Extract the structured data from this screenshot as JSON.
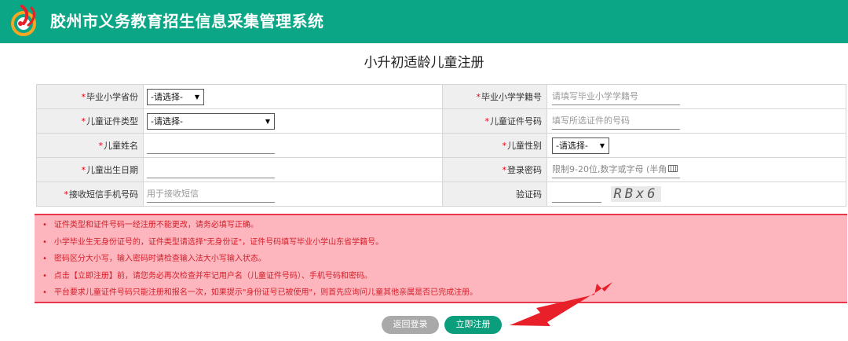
{
  "header": {
    "system_title": "胶州市义务教育招生信息采集管理系统",
    "logo_icon": "school-emblem-icon",
    "background_color": "#0aa685"
  },
  "page": {
    "title": "小升初适龄儿童注册"
  },
  "form": {
    "required_mark": "*",
    "primary_school_province": {
      "label": "毕业小学省份",
      "value": "-请选择-"
    },
    "primary_school_student_no": {
      "label": "毕业小学学籍号",
      "placeholder": "请填写毕业小学学籍号"
    },
    "child_id_type": {
      "label": "儿童证件类型",
      "value": "-请选择-"
    },
    "child_id_no": {
      "label": "儿童证件号码",
      "placeholder": "填写所选证件的号码"
    },
    "child_name": {
      "label": "儿童姓名",
      "value": ""
    },
    "child_gender": {
      "label": "儿童性别",
      "value": "-请选择-"
    },
    "child_birth_date": {
      "label": "儿童出生日期",
      "value": ""
    },
    "login_password": {
      "label": "登录密码",
      "placeholder": "限制9-20位,数字或字母 (半角"
    },
    "sms_phone": {
      "label": "接收短信手机号码",
      "placeholder": "用于接收短信"
    },
    "captcha": {
      "label": "验证码",
      "image_text": "RBx6"
    }
  },
  "notices": [
    "证件类型和证件号码一经注册不能更改，请务必填写正确。",
    "小学毕业生无身份证号的，证件类型请选择\"无身份证\"，证件号码填写毕业小学山东省学籍号。",
    "密码区分大小写，输入密码时请检查输入法大小写输入状态。",
    "点击【立即注册】前，请您务必再次检查并牢记用户名（儿童证件号码）、手机号码和密码。",
    "平台要求儿童证件号码只能注册和报名一次，如果提示\"身份证号已被使用\"，则首先应询问儿童其他亲属是否已完成注册。"
  ],
  "notice_bullet": "•",
  "buttons": {
    "back": "返回登录",
    "register": "立即注册"
  },
  "colors": {
    "notice_bg": "#fdb6be",
    "notice_text": "#d61e2a",
    "annotation_arrow": "#e8202a"
  }
}
